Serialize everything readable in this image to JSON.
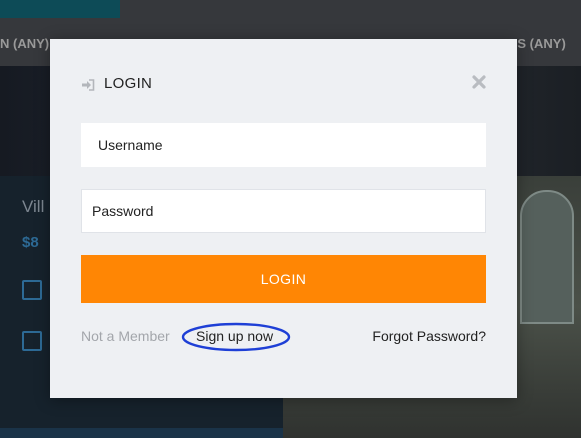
{
  "background": {
    "filter_left": "N (ANY)",
    "filter_right": "US (ANY)",
    "card_title": "Vill",
    "card_price": "$8"
  },
  "modal": {
    "title": "LOGIN",
    "title_icon": "login-arrow-icon",
    "close_icon": "close-icon",
    "username_placeholder": "Username",
    "password_placeholder": "Password",
    "login_button": "LOGIN",
    "not_member_text": "Not a Member",
    "signup_link": "Sign up now",
    "forgot_link": "Forgot Password?"
  },
  "colors": {
    "accent": "#ff8604",
    "highlight_ring": "#1e3fd6",
    "modal_bg": "#eef0f3"
  }
}
